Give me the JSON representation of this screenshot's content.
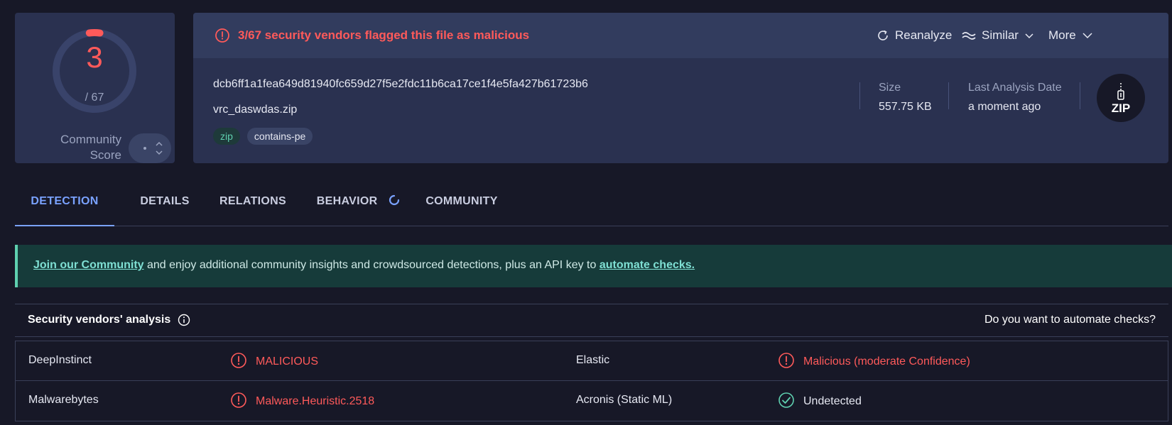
{
  "score": {
    "detections": "3",
    "total": "/ 67",
    "community_label_line1": "Community",
    "community_label_line2": "Score",
    "detected_fraction": 0.045
  },
  "alert": {
    "text": "3/67 security vendors flagged this file as malicious"
  },
  "actions": {
    "reanalyze": "Reanalyze",
    "similar": "Similar",
    "more": "More"
  },
  "file": {
    "hash": "dcb6ff1a1fea649d81940fc659d27f5e2fdc11b6ca17ce1f4e5fa427b61723b6",
    "name": "vrc_daswdas.zip",
    "tags": [
      "zip",
      "contains-pe"
    ],
    "size_label": "Size",
    "size_value": "557.75 KB",
    "date_label": "Last Analysis Date",
    "date_value": "a moment ago",
    "type_badge": "ZIP"
  },
  "tabs": [
    {
      "label": "DETECTION",
      "active": true
    },
    {
      "label": "DETAILS",
      "active": false
    },
    {
      "label": "RELATIONS",
      "active": false
    },
    {
      "label": "BEHAVIOR",
      "active": false
    },
    {
      "label": "COMMUNITY",
      "active": false
    }
  ],
  "banner": {
    "link1": "Join our Community",
    "middle": " and enjoy additional community insights and crowdsourced detections, plus an API key to ",
    "link2": "automate checks."
  },
  "vendors": {
    "title": "Security vendors' analysis",
    "cta": "Do you want to automate checks?",
    "rows": [
      {
        "left_name": "DeepInstinct",
        "left_result": "MALICIOUS",
        "left_status": "malicious",
        "right_name": "Elastic",
        "right_result": "Malicious (moderate Confidence)",
        "right_status": "malicious"
      },
      {
        "left_name": "Malwarebytes",
        "left_result": "Malware.Heuristic.2518",
        "left_status": "malicious",
        "right_name": "Acronis (Static ML)",
        "right_result": "Undetected",
        "right_status": "undetected"
      }
    ]
  },
  "colors": {
    "malicious": "#ff5a5a",
    "accent": "#7aa2ff",
    "undetected": "#5fd0b0"
  }
}
